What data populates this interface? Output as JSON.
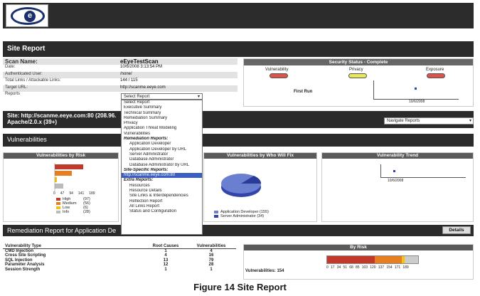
{
  "header": {
    "logo_letter": "e"
  },
  "site_report": {
    "title": "Site Report"
  },
  "info": [
    {
      "key": "Scan Name:",
      "value": "eEyeTestScan"
    },
    {
      "key": "Date:",
      "value": "10/6/2008 3:13:54 PM"
    },
    {
      "key": "Authenticated User:",
      "value": "/none/"
    },
    {
      "key": "Total Links / Attackable Links:",
      "value": "144 / 115"
    },
    {
      "key": "Target URL:",
      "value": "http://scanme.eeye.com"
    },
    {
      "key": "Reports",
      "value": ""
    }
  ],
  "report_select": {
    "value": "Select Report"
  },
  "security_status": {
    "title": "Security Status - Complete",
    "vulnerability": "Vulnerability",
    "privacy": "Privacy",
    "exposure": "Exposure",
    "first_run": "First Run",
    "date": "10/6/2008",
    "colors": {
      "vulnerability": "#d9534f",
      "privacy": "#e8e85a",
      "exposure": "#d9534f"
    }
  },
  "site": {
    "line1": "Site: http://scanme.eeye.com:80 (208.96.",
    "line2": "Apache/2.0.x (39+)"
  },
  "navigate": {
    "value": "Navigate Reports"
  },
  "vulnerabilities": {
    "title": "Vulnerabilities"
  },
  "panels": {
    "by_risk": "Vulnerabilities by Risk",
    "who_will_fix": "Vulnerabilities by Who Will Fix",
    "trend": "Vulnerability Trend"
  },
  "risk_chart": {
    "ticks": [
      "0",
      "47",
      "94",
      "141",
      "189"
    ],
    "legend": [
      {
        "label": "High",
        "count": "(97)",
        "color": "#c0392b"
      },
      {
        "label": "Medium",
        "count": "(56)",
        "color": "#e67e22"
      },
      {
        "label": "Low",
        "count": "(6)",
        "color": "#f1c40f"
      },
      {
        "label": "Info",
        "count": "(28)",
        "color": "#bbbbbb"
      }
    ]
  },
  "who_fix": {
    "legend": [
      {
        "label": "Application Developer (155)",
        "color": "#6a7fd0"
      },
      {
        "label": "Server Administrator (34)",
        "color": "#3344aa"
      }
    ]
  },
  "trend": {
    "date": "10/6/2008"
  },
  "dropdown": [
    {
      "label": "Select Report",
      "type": "item"
    },
    {
      "label": "Executive Summary",
      "type": "item"
    },
    {
      "label": "Technical Summary",
      "type": "item"
    },
    {
      "label": "Remediation Summary",
      "type": "item"
    },
    {
      "label": "Privacy",
      "type": "item"
    },
    {
      "label": "Application Threat Modeling",
      "type": "item"
    },
    {
      "label": "Vulnerabilities",
      "type": "item"
    },
    {
      "label": "Remediation Reports:",
      "type": "grp"
    },
    {
      "label": "Application Developer",
      "type": "ind"
    },
    {
      "label": "Application Developer by URL",
      "type": "ind"
    },
    {
      "label": "Server Administrator",
      "type": "ind"
    },
    {
      "label": "Database Administrator",
      "type": "ind"
    },
    {
      "label": "Database Administrator by URL",
      "type": "ind"
    },
    {
      "label": "Site-Specific Reports:",
      "type": "grp"
    },
    {
      "label": "http://scanme.eeye.com:80",
      "type": "sel"
    },
    {
      "label": "Extra Reports:",
      "type": "grp"
    },
    {
      "label": "Resources",
      "type": "ind"
    },
    {
      "label": "Resource Details",
      "type": "ind"
    },
    {
      "label": "Site Links & Interdependencies",
      "type": "ind"
    },
    {
      "label": "Reflection Report",
      "type": "ind"
    },
    {
      "label": "All Links Report",
      "type": "ind"
    },
    {
      "label": "Status and Configuration",
      "type": "ind"
    }
  ],
  "remediation": {
    "title": "Remediation Report for Application De",
    "details": "Details"
  },
  "vuln_table": {
    "headers": [
      "Vulnerability Type",
      "Root Causes",
      "Vulnerabilities"
    ],
    "rows": [
      [
        "CMD Injection",
        "1",
        "4"
      ],
      [
        "Cross Site Scripting",
        "4",
        "16"
      ],
      [
        "SQL Injection",
        "13",
        "79"
      ],
      [
        "Parameter Analysis",
        "12",
        "28"
      ],
      [
        "Session Strength",
        "1",
        "1"
      ]
    ]
  },
  "by_risk_bar": {
    "title": "By Risk",
    "label": "Vulnerabilities: 154",
    "ticks": [
      "0",
      "17",
      "34",
      "51",
      "68",
      "85",
      "103",
      "120",
      "137",
      "154",
      "171",
      "189"
    ]
  },
  "caption": "Figure 14  Site Report"
}
